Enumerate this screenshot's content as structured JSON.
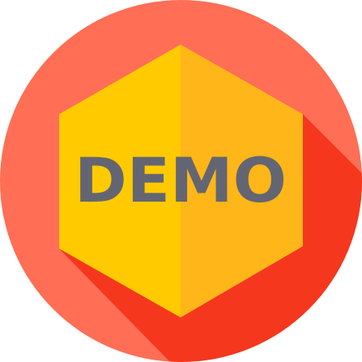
{
  "badge": {
    "label": "DEMO",
    "icon_name": "demo-badge-icon",
    "colors": {
      "circle": "#FF6E55",
      "long_shadow": "#F5371E",
      "hexagon_left": "#FFCA00",
      "hexagon_right": "#FFB618",
      "text": "#636672"
    }
  }
}
